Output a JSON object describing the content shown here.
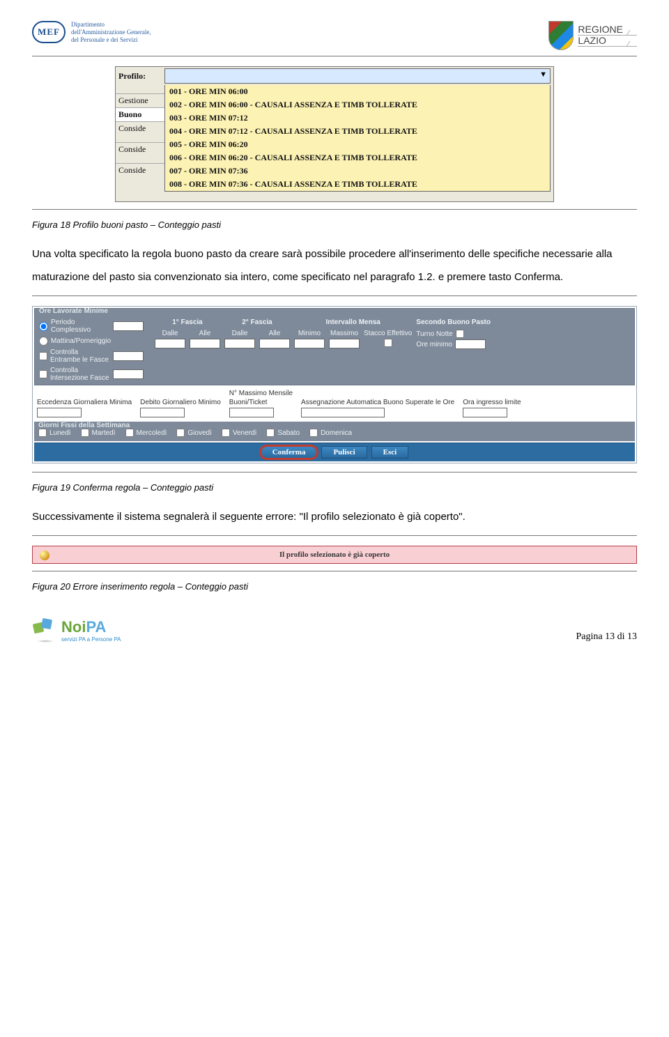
{
  "header": {
    "mef_logo": "MEF",
    "mef_line1": "Dipartimento",
    "mef_line2": "dell'Amministrazione Generale,",
    "mef_line3": "del Personale e dei Servizi",
    "region_line1": "REGIONE",
    "region_line2": "LAZIO"
  },
  "profilo_figure": {
    "field_label": "Profilo:",
    "side_labels": [
      "Gestione",
      "Buono",
      "Conside",
      "Conside",
      "Conside"
    ],
    "options": [
      "001 - ORE MIN 06:00",
      "002 - ORE MIN 06:00 - CAUSALI ASSENZA E TIMB TOLLERATE",
      "003 - ORE MIN 07:12",
      "004 - ORE MIN 07:12 - CAUSALI ASSENZA E TIMB TOLLERATE",
      "005 - ORE MIN 06:20",
      "006 - ORE MIN 06:20 - CAUSALI ASSENZA E TIMB TOLLERATE",
      "007 - ORE MIN 07:36",
      "008 - ORE MIN 07:36 - CAUSALI ASSENZA E TIMB TOLLERATE"
    ]
  },
  "caption1": "Figura 18 Profilo buoni pasto – Conteggio pasti",
  "paragraph1": "Una volta specificato la regola buono pasto da creare sarà possibile procedere all'inserimento delle specifiche necessarie alla maturazione del pasto sia convenzionato sia intero, come specificato nel paragrafo 1.2. e premere tasto Conferma.",
  "form": {
    "fs1_title": "Ore Lavorate Minime",
    "periodo": "Periodo Complessivo",
    "mattina": "Mattina/Pomeriggio",
    "entrambe": "Controlla Entrambe le Fasce",
    "intersez": "Controlla Intersezione Fasce",
    "fascia1": "1° Fascia",
    "fascia2": "2° Fascia",
    "dalle": "Dalle",
    "alle": "Alle",
    "intmensa": "Intervallo Mensa",
    "min": "Minimo",
    "max": "Massimo",
    "stacco": "Stacco Effettivo",
    "secondo": "Secondo Buono Pasto",
    "turno": "Turno Notte",
    "oremin": "Ore minimo",
    "row2": {
      "ecc": "Eccedenza Giornaliera Minima",
      "deb": "Debito Giornaliero Minimo",
      "nmax1": "N° Massimo Mensile",
      "nmax2": "Buoni/Ticket",
      "ass": "Assegnazione Automatica Buono Superate le Ore",
      "ora": "Ora ingresso limite"
    },
    "fs_days_title": "Giorni Fissi della Settimana",
    "days": [
      "Lunedì",
      "Martedì",
      "Mercoledì",
      "Giovedì",
      "Venerdì",
      "Sabato",
      "Domenica"
    ],
    "btn_conferma": "Conferma",
    "btn_pulisci": "Pulisci",
    "btn_esci": "Esci"
  },
  "caption2": "Figura 19 Conferma regola – Conteggio pasti",
  "paragraph2": "Successivamente il sistema segnalerà il seguente errore: \"Il profilo selezionato è già coperto\".",
  "error_text": "Il profilo selezionato è già coperto",
  "caption3": "Figura 20 Errore inserimento regola – Conteggio pasti",
  "footer": {
    "noipa_main": "NoiPA",
    "noipa_sub": "servizi PA a Persone PA",
    "page": "Pagina 13 di 13"
  }
}
